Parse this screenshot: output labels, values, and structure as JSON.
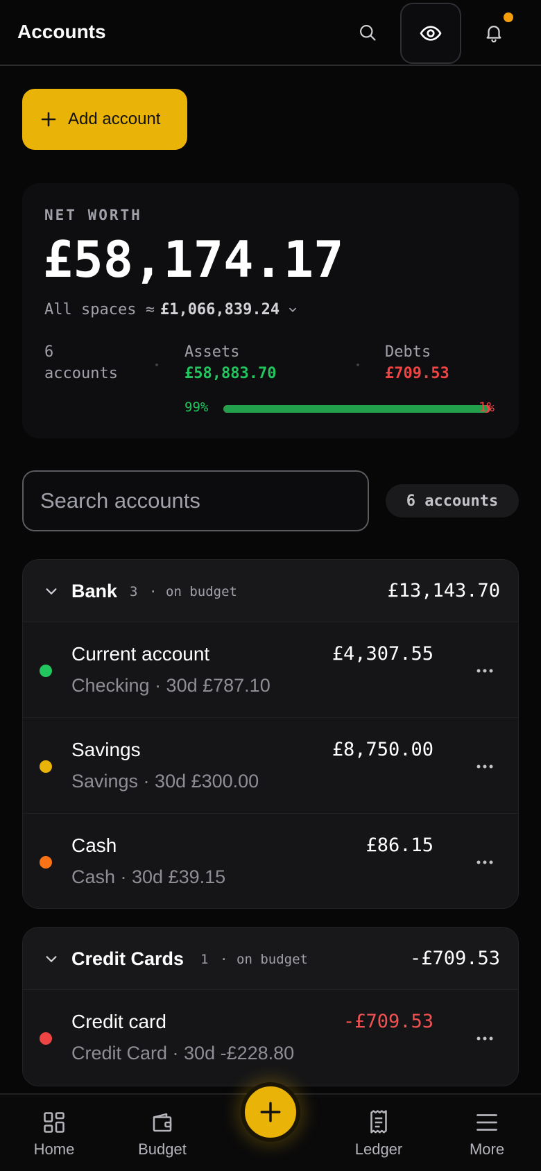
{
  "header": {
    "title": "Accounts",
    "icons": {
      "search": "search-icon",
      "visibility": "eye-icon",
      "notifications": "bell-icon"
    }
  },
  "actions": {
    "add_account_label": "Add account"
  },
  "net_worth": {
    "label": "NET WORTH",
    "value": "£58,174.17",
    "all_spaces_label": "All spaces ≈",
    "all_spaces_value": "£1,066,839.24",
    "accounts_count": "6",
    "accounts_word": "accounts",
    "assets_label": "Assets",
    "assets_value": "£58,883.70",
    "debts_label": "Debts",
    "debts_value": "£709.53",
    "assets_pct": "99%",
    "debts_pct": "1%",
    "assets_fraction": 0.99
  },
  "search": {
    "placeholder": "Search accounts",
    "count_label": "6 accounts"
  },
  "groups": [
    {
      "name": "Bank",
      "count": "3",
      "separator": "·",
      "status": "on budget",
      "total": "£13,143.70",
      "accounts": [
        {
          "name": "Current account",
          "subtitle": "Checking · 30d £787.10",
          "amount": "£4,307.55",
          "dot_color": "#22c55e"
        },
        {
          "name": "Savings",
          "subtitle": "Savings · 30d £300.00",
          "amount": "£8,750.00",
          "dot_color": "#eab308"
        },
        {
          "name": "Cash",
          "subtitle": "Cash · 30d £39.15",
          "amount": "£86.15",
          "dot_color": "#f97316"
        }
      ]
    },
    {
      "name": "Credit Cards",
      "count": "1",
      "separator": "·",
      "status": "on budget",
      "total": "-£709.53",
      "accounts": [
        {
          "name": "Credit card",
          "subtitle": "Credit Card · 30d -£228.80",
          "amount": "-£709.53",
          "dot_color": "#ef4444"
        }
      ]
    }
  ],
  "bottom_nav": [
    {
      "label": "Home",
      "icon": "grid-icon"
    },
    {
      "label": "Budget",
      "icon": "wallet-icon"
    },
    {
      "label": "Ledger",
      "icon": "receipt-icon"
    },
    {
      "label": "More",
      "icon": "menu-icon"
    }
  ],
  "colors": {
    "accent": "#eab308",
    "positive": "#22c55e",
    "negative": "#ef4444",
    "background": "#070708"
  }
}
